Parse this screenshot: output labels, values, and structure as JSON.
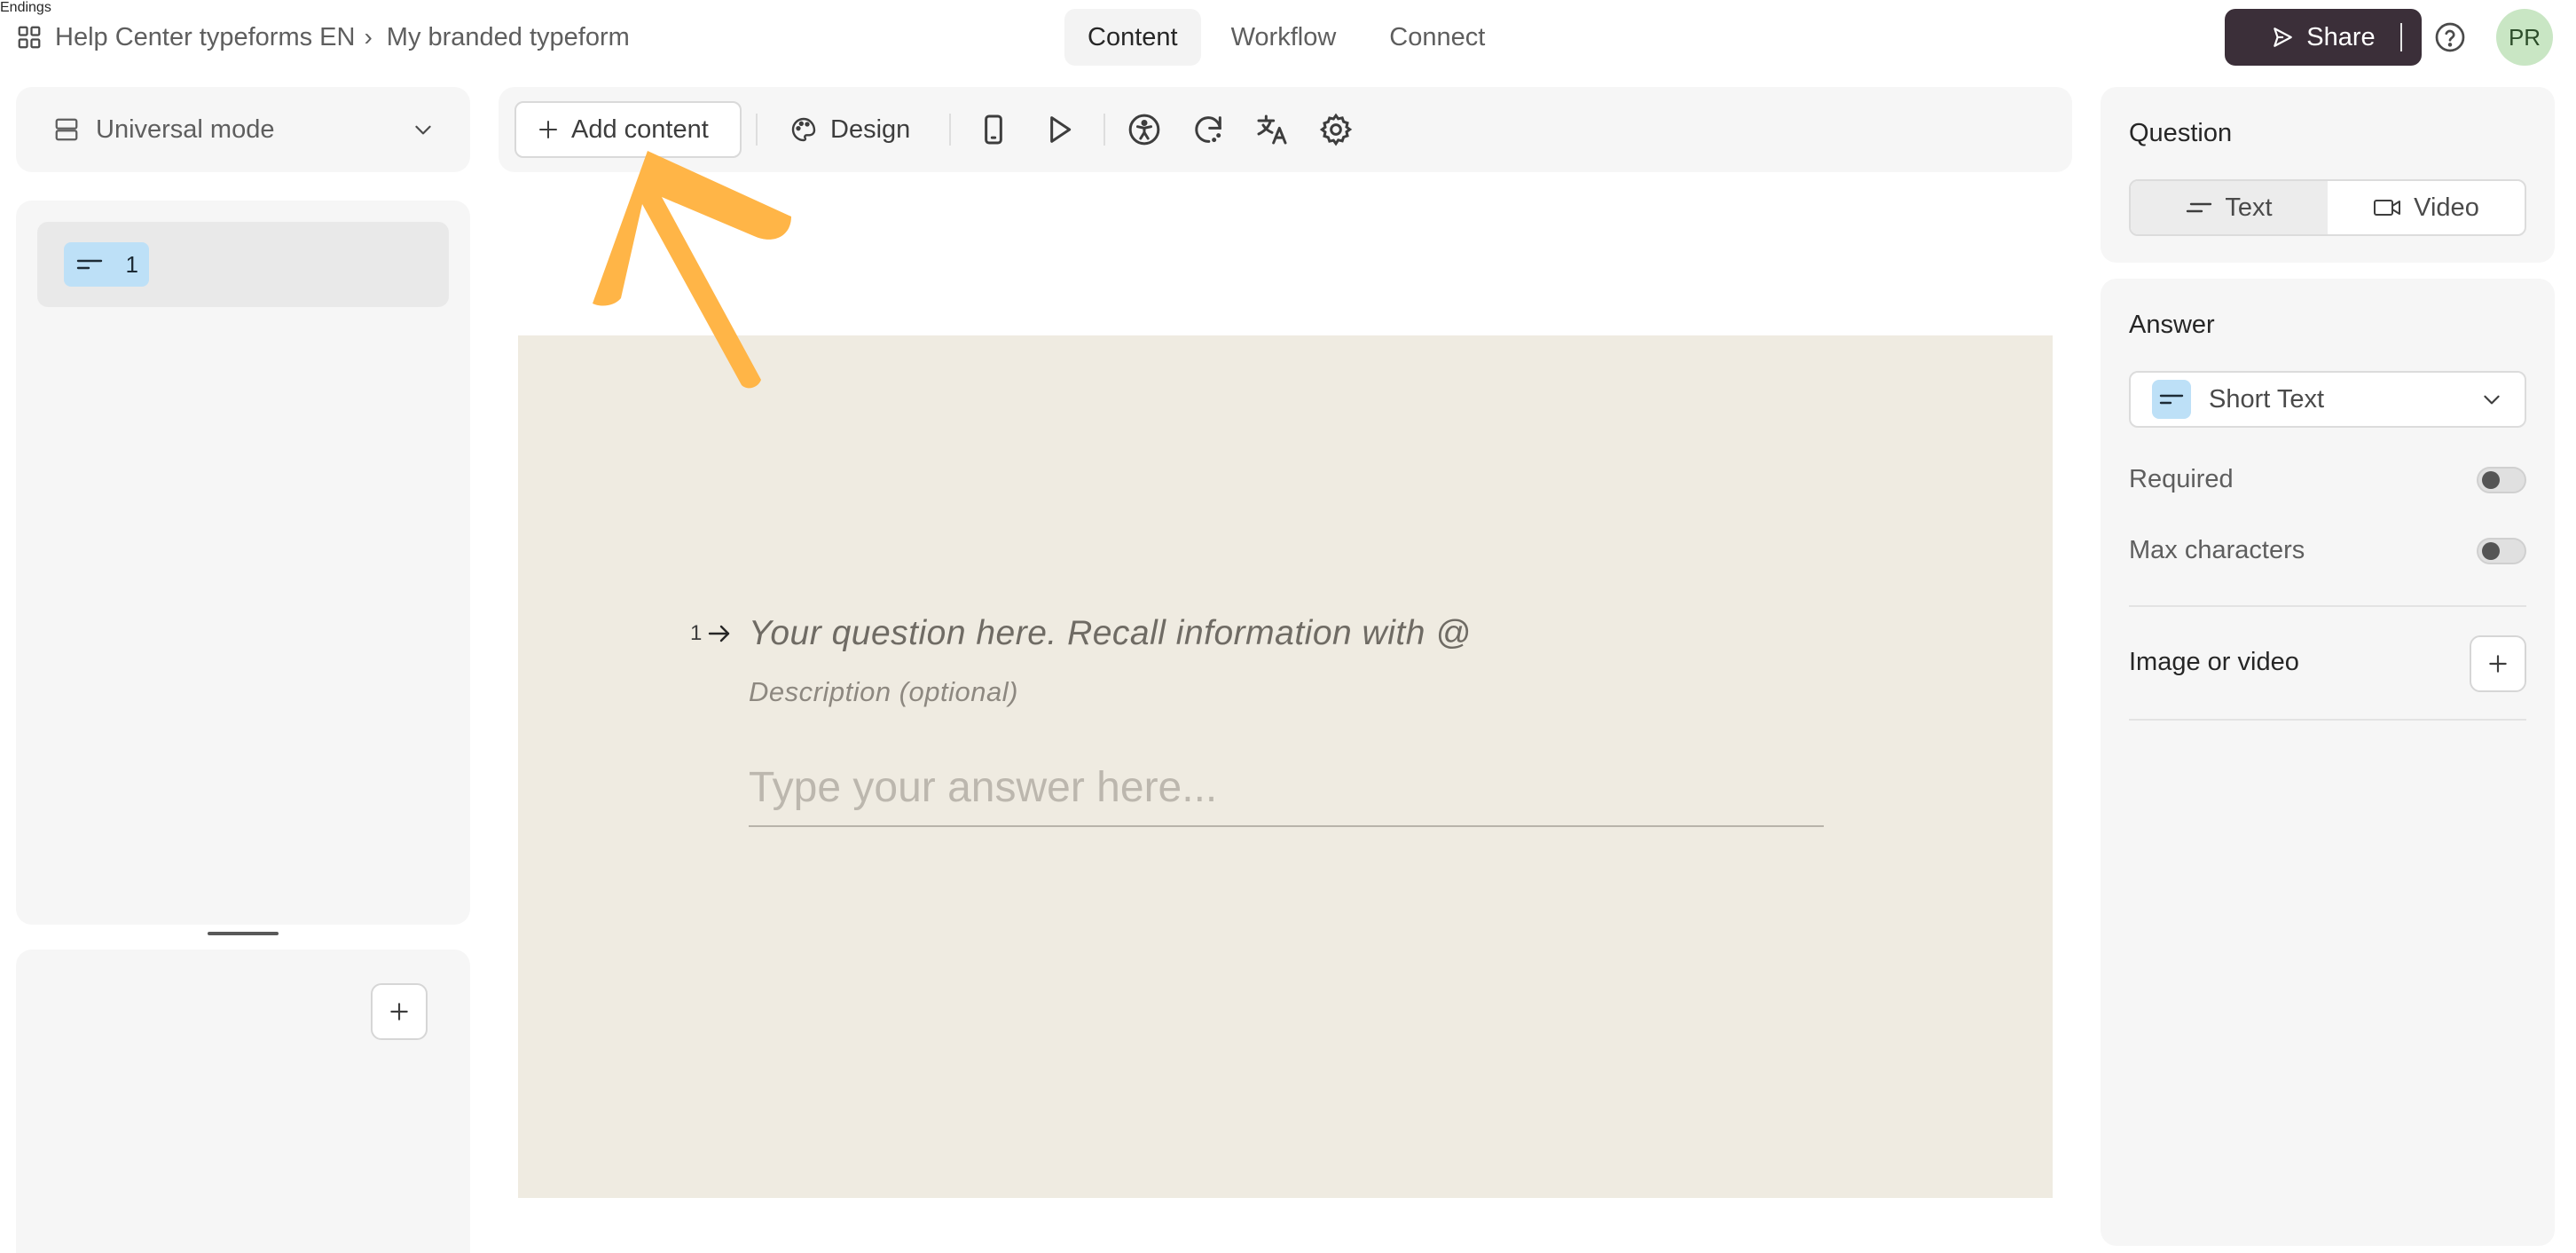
{
  "breadcrumb": {
    "workspace": "Help Center typeforms EN",
    "separator": "›",
    "form": "My branded typeform"
  },
  "tabs": [
    {
      "label": "Content",
      "active": true
    },
    {
      "label": "Workflow",
      "active": false
    },
    {
      "label": "Connect",
      "active": false
    }
  ],
  "share_label": "Share",
  "avatar_initials": "PR",
  "left": {
    "mode_label": "Universal mode",
    "question_items": [
      {
        "number": "1",
        "icon": "short-text-icon"
      }
    ],
    "endings_label": "Endings"
  },
  "toolbar": {
    "add_content_label": "Add content",
    "design_label": "Design",
    "icons": [
      "mobile-preview-icon",
      "play-icon",
      "accessibility-icon",
      "logic-icon",
      "translate-icon",
      "settings-icon"
    ]
  },
  "canvas": {
    "question_number": "1",
    "question_placeholder": "Your question here. Recall information with @",
    "description_placeholder": "Description (optional)",
    "answer_placeholder": "Type your answer here..."
  },
  "right": {
    "question_heading": "Question",
    "question_options": [
      {
        "label": "Text",
        "icon": "text-icon",
        "selected": true
      },
      {
        "label": "Video",
        "icon": "video-icon",
        "selected": false
      }
    ],
    "answer_heading": "Answer",
    "answer_type": "Short Text",
    "settings": [
      {
        "label": "Required",
        "on": false
      },
      {
        "label": "Max characters",
        "on": false
      }
    ],
    "media_label": "Image or video"
  },
  "colors": {
    "share_bg": "#3b2f39",
    "canvas_bg": "#efebe1",
    "arrow": "#ffb547",
    "badge": "#bde0f7",
    "avatar": "#c9e6c4"
  }
}
